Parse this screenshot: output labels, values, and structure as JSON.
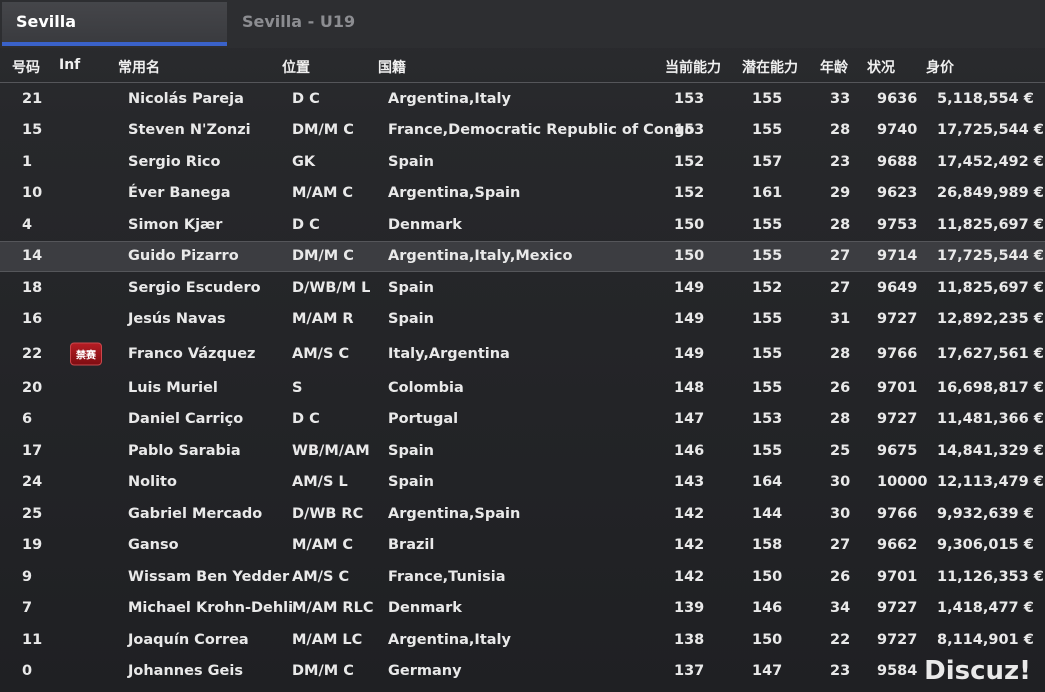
{
  "tabs": [
    {
      "label": "Sevilla"
    },
    {
      "label": "Sevilla - U19"
    }
  ],
  "columns": {
    "num": "号码",
    "inf": "Inf",
    "name": "常用名",
    "pos": "位置",
    "nat": "国籍",
    "ca": "当前能力",
    "pa": "潜在能力",
    "age": "年龄",
    "cond": "状况",
    "val": "身价"
  },
  "rows": [
    {
      "num": "21",
      "inf": "",
      "name": "Nicolás Pareja",
      "pos": "D C",
      "nat": "Argentina,Italy",
      "ca": "153",
      "pa": "155",
      "age": "33",
      "cond": "9636",
      "val": "5,118,554 €"
    },
    {
      "num": "15",
      "inf": "",
      "name": "Steven N'Zonzi",
      "pos": "DM/M C",
      "nat": "France,Democratic Republic of Congo",
      "ca": "153",
      "pa": "155",
      "age": "28",
      "cond": "9740",
      "val": "17,725,544 €"
    },
    {
      "num": "1",
      "inf": "",
      "name": "Sergio Rico",
      "pos": "GK",
      "nat": "Spain",
      "ca": "152",
      "pa": "157",
      "age": "23",
      "cond": "9688",
      "val": "17,452,492 €"
    },
    {
      "num": "10",
      "inf": "",
      "name": "Éver Banega",
      "pos": "M/AM C",
      "nat": "Argentina,Spain",
      "ca": "152",
      "pa": "161",
      "age": "29",
      "cond": "9623",
      "val": "26,849,989 €"
    },
    {
      "num": "4",
      "inf": "",
      "name": "Simon Kjær",
      "pos": "D C",
      "nat": "Denmark",
      "ca": "150",
      "pa": "155",
      "age": "28",
      "cond": "9753",
      "val": "11,825,697 €"
    },
    {
      "num": "14",
      "inf": "",
      "name": "Guido Pizarro",
      "pos": "DM/M C",
      "nat": "Argentina,Italy,Mexico",
      "ca": "150",
      "pa": "155",
      "age": "27",
      "cond": "9714",
      "val": "17,725,544 €",
      "selected": true
    },
    {
      "num": "18",
      "inf": "",
      "name": "Sergio Escudero",
      "pos": "D/WB/M L",
      "nat": "Spain",
      "ca": "149",
      "pa": "152",
      "age": "27",
      "cond": "9649",
      "val": "11,825,697 €"
    },
    {
      "num": "16",
      "inf": "",
      "name": "Jesús Navas",
      "pos": "M/AM R",
      "nat": "Spain",
      "ca": "149",
      "pa": "155",
      "age": "31",
      "cond": "9727",
      "val": "12,892,235 €"
    },
    {
      "num": "22",
      "inf": "禁赛",
      "name": "Franco Vázquez",
      "pos": "AM/S C",
      "nat": "Italy,Argentina",
      "ca": "149",
      "pa": "155",
      "age": "28",
      "cond": "9766",
      "val": "17,627,561 €"
    },
    {
      "num": "20",
      "inf": "",
      "name": "Luis Muriel",
      "pos": "S",
      "nat": "Colombia",
      "ca": "148",
      "pa": "155",
      "age": "26",
      "cond": "9701",
      "val": "16,698,817 €"
    },
    {
      "num": "6",
      "inf": "",
      "name": "Daniel Carriço",
      "pos": "D C",
      "nat": "Portugal",
      "ca": "147",
      "pa": "153",
      "age": "28",
      "cond": "9727",
      "val": "11,481,366 €"
    },
    {
      "num": "17",
      "inf": "",
      "name": "Pablo Sarabia",
      "pos": "WB/M/AM",
      "nat": "Spain",
      "ca": "146",
      "pa": "155",
      "age": "25",
      "cond": "9675",
      "val": "14,841,329 €"
    },
    {
      "num": "24",
      "inf": "",
      "name": "Nolito",
      "pos": "AM/S L",
      "nat": "Spain",
      "ca": "143",
      "pa": "164",
      "age": "30",
      "cond": "10000",
      "val": "12,113,479 €"
    },
    {
      "num": "25",
      "inf": "",
      "name": "Gabriel Mercado",
      "pos": "D/WB RC",
      "nat": "Argentina,Spain",
      "ca": "142",
      "pa": "144",
      "age": "30",
      "cond": "9766",
      "val": "9,932,639 €"
    },
    {
      "num": "19",
      "inf": "",
      "name": "Ganso",
      "pos": "M/AM C",
      "nat": "Brazil",
      "ca": "142",
      "pa": "158",
      "age": "27",
      "cond": "9662",
      "val": "9,306,015 €"
    },
    {
      "num": "9",
      "inf": "",
      "name": "Wissam Ben Yedder",
      "pos": "AM/S C",
      "nat": "France,Tunisia",
      "ca": "142",
      "pa": "150",
      "age": "26",
      "cond": "9701",
      "val": "11,126,353 €"
    },
    {
      "num": "7",
      "inf": "",
      "name": "Michael Krohn-Dehli",
      "pos": "M/AM RLC",
      "nat": "Denmark",
      "ca": "139",
      "pa": "146",
      "age": "34",
      "cond": "9727",
      "val": "1,418,477 €"
    },
    {
      "num": "11",
      "inf": "",
      "name": "Joaquín Correa",
      "pos": "M/AM LC",
      "nat": "Argentina,Italy",
      "ca": "138",
      "pa": "150",
      "age": "22",
      "cond": "9727",
      "val": "8,114,901 €"
    },
    {
      "num": "0",
      "inf": "",
      "name": "Johannes Geis",
      "pos": "DM/M C",
      "nat": "Germany",
      "ca": "137",
      "pa": "147",
      "age": "23",
      "cond": "9584",
      "val": ""
    }
  ],
  "watermark": "Discuz!",
  "colors": {
    "accent": "#3a62c9",
    "ban_badge": "#9e1219",
    "background": "#242528"
  }
}
